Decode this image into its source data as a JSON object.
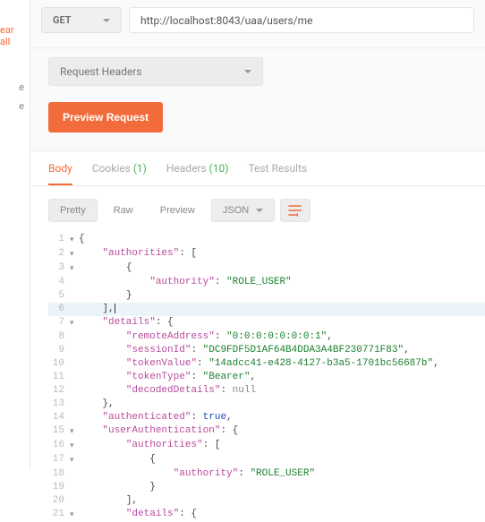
{
  "sidebar": {
    "clear_all": "ear all",
    "item1": "e",
    "item2": "e"
  },
  "request": {
    "method": "GET",
    "url": "http://localhost:8043/uaa/users/me",
    "headers_dropdown": "Request Headers",
    "preview_button": "Preview Request"
  },
  "tabs": {
    "body": "Body",
    "cookies": "Cookies",
    "cookies_count": "(1)",
    "headers": "Headers",
    "headers_count": "(10)",
    "test_results": "Test Results"
  },
  "display": {
    "pretty": "Pretty",
    "raw": "Raw",
    "preview": "Preview",
    "format": "JSON"
  },
  "code_lines": [
    {
      "n": 1,
      "fold": "▾",
      "indent": 0,
      "tokens": [
        {
          "t": "{"
        }
      ]
    },
    {
      "n": 2,
      "fold": "▾",
      "indent": 1,
      "tokens": [
        {
          "t": "\"authorities\"",
          "c": "string-key"
        },
        {
          "t": ": ["
        }
      ]
    },
    {
      "n": 3,
      "fold": "▾",
      "indent": 2,
      "tokens": [
        {
          "t": "{"
        }
      ]
    },
    {
      "n": 4,
      "fold": "",
      "indent": 3,
      "tokens": [
        {
          "t": "\"authority\"",
          "c": "string-key"
        },
        {
          "t": ": "
        },
        {
          "t": "\"ROLE_USER\"",
          "c": "string-val"
        }
      ]
    },
    {
      "n": 5,
      "fold": "",
      "indent": 2,
      "tokens": [
        {
          "t": "}"
        }
      ]
    },
    {
      "n": 6,
      "fold": "",
      "indent": 1,
      "tokens": [
        {
          "t": "],"
        }
      ],
      "current": true
    },
    {
      "n": 7,
      "fold": "▾",
      "indent": 1,
      "tokens": [
        {
          "t": "\"details\"",
          "c": "string-key"
        },
        {
          "t": ": {"
        }
      ]
    },
    {
      "n": 8,
      "fold": "",
      "indent": 2,
      "tokens": [
        {
          "t": "\"remoteAddress\"",
          "c": "string-key"
        },
        {
          "t": ": "
        },
        {
          "t": "\"0:0:0:0:0:0:0:1\"",
          "c": "string-val"
        },
        {
          "t": ","
        }
      ]
    },
    {
      "n": 9,
      "fold": "",
      "indent": 2,
      "tokens": [
        {
          "t": "\"sessionId\"",
          "c": "string-key"
        },
        {
          "t": ": "
        },
        {
          "t": "\"DC9FDF5D1AF64B4DDA3A4BF230771F83\"",
          "c": "string-val"
        },
        {
          "t": ","
        }
      ]
    },
    {
      "n": 10,
      "fold": "",
      "indent": 2,
      "tokens": [
        {
          "t": "\"tokenValue\"",
          "c": "string-key"
        },
        {
          "t": ": "
        },
        {
          "t": "\"14adcc41-e428-4127-b3a5-1701bc56687b\"",
          "c": "string-val"
        },
        {
          "t": ","
        }
      ]
    },
    {
      "n": 11,
      "fold": "",
      "indent": 2,
      "tokens": [
        {
          "t": "\"tokenType\"",
          "c": "string-key"
        },
        {
          "t": ": "
        },
        {
          "t": "\"Bearer\"",
          "c": "string-val"
        },
        {
          "t": ","
        }
      ]
    },
    {
      "n": 12,
      "fold": "",
      "indent": 2,
      "tokens": [
        {
          "t": "\"decodedDetails\"",
          "c": "string-key"
        },
        {
          "t": ": "
        },
        {
          "t": "null",
          "c": "null-val"
        }
      ]
    },
    {
      "n": 13,
      "fold": "",
      "indent": 1,
      "tokens": [
        {
          "t": "},"
        }
      ]
    },
    {
      "n": 14,
      "fold": "",
      "indent": 1,
      "tokens": [
        {
          "t": "\"authenticated\"",
          "c": "string-key"
        },
        {
          "t": ": "
        },
        {
          "t": "true",
          "c": "keyword"
        },
        {
          "t": ","
        }
      ]
    },
    {
      "n": 15,
      "fold": "▾",
      "indent": 1,
      "tokens": [
        {
          "t": "\"userAuthentication\"",
          "c": "string-key"
        },
        {
          "t": ": {"
        }
      ]
    },
    {
      "n": 16,
      "fold": "▾",
      "indent": 2,
      "tokens": [
        {
          "t": "\"authorities\"",
          "c": "string-key"
        },
        {
          "t": ": ["
        }
      ]
    },
    {
      "n": 17,
      "fold": "▾",
      "indent": 3,
      "tokens": [
        {
          "t": "{"
        }
      ]
    },
    {
      "n": 18,
      "fold": "",
      "indent": 4,
      "tokens": [
        {
          "t": "\"authority\"",
          "c": "string-key"
        },
        {
          "t": ": "
        },
        {
          "t": "\"ROLE_USER\"",
          "c": "string-val"
        }
      ]
    },
    {
      "n": 19,
      "fold": "",
      "indent": 3,
      "tokens": [
        {
          "t": "}"
        }
      ]
    },
    {
      "n": 20,
      "fold": "",
      "indent": 2,
      "tokens": [
        {
          "t": "],"
        }
      ]
    },
    {
      "n": 21,
      "fold": "▾",
      "indent": 2,
      "tokens": [
        {
          "t": "\"details\"",
          "c": "string-key"
        },
        {
          "t": ": {"
        }
      ]
    }
  ]
}
